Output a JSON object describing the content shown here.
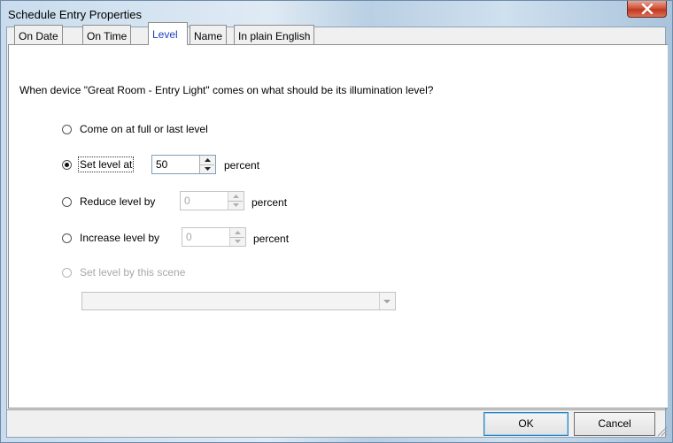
{
  "window": {
    "title": "Schedule Entry Properties"
  },
  "tabs": [
    {
      "label": "On Date",
      "active": false
    },
    {
      "label": "On Time",
      "active": false
    },
    {
      "label": "Level",
      "active": true
    },
    {
      "label": "Name",
      "active": false
    },
    {
      "label": "In plain English",
      "active": false
    }
  ],
  "level": {
    "prompt": "When device \"Great Room - Entry Light\" comes on what should be its illumination level?",
    "options": {
      "full": {
        "label": "Come on at full or last level",
        "selected": false,
        "enabled": true
      },
      "set": {
        "label": "Set level at",
        "selected": true,
        "enabled": true,
        "value": "50",
        "unit": "percent"
      },
      "reduce": {
        "label": "Reduce level by",
        "selected": false,
        "enabled": true,
        "value": "0",
        "unit": "percent"
      },
      "increase": {
        "label": "Increase level by",
        "selected": false,
        "enabled": true,
        "value": "0",
        "unit": "percent"
      },
      "scene": {
        "label": "Set level by this scene",
        "selected": false,
        "enabled": false,
        "value": ""
      }
    }
  },
  "buttons": {
    "ok": "OK",
    "cancel": "Cancel"
  },
  "colors": {
    "active_tab_text": "#1d3fbf",
    "close_button": "#c1381f"
  },
  "icons": {
    "close": "close-icon",
    "spin_up": "spin-up-arrow-icon",
    "spin_down": "spin-down-arrow-icon",
    "dropdown": "chevron-down-icon",
    "grip": "resize-grip-icon"
  }
}
